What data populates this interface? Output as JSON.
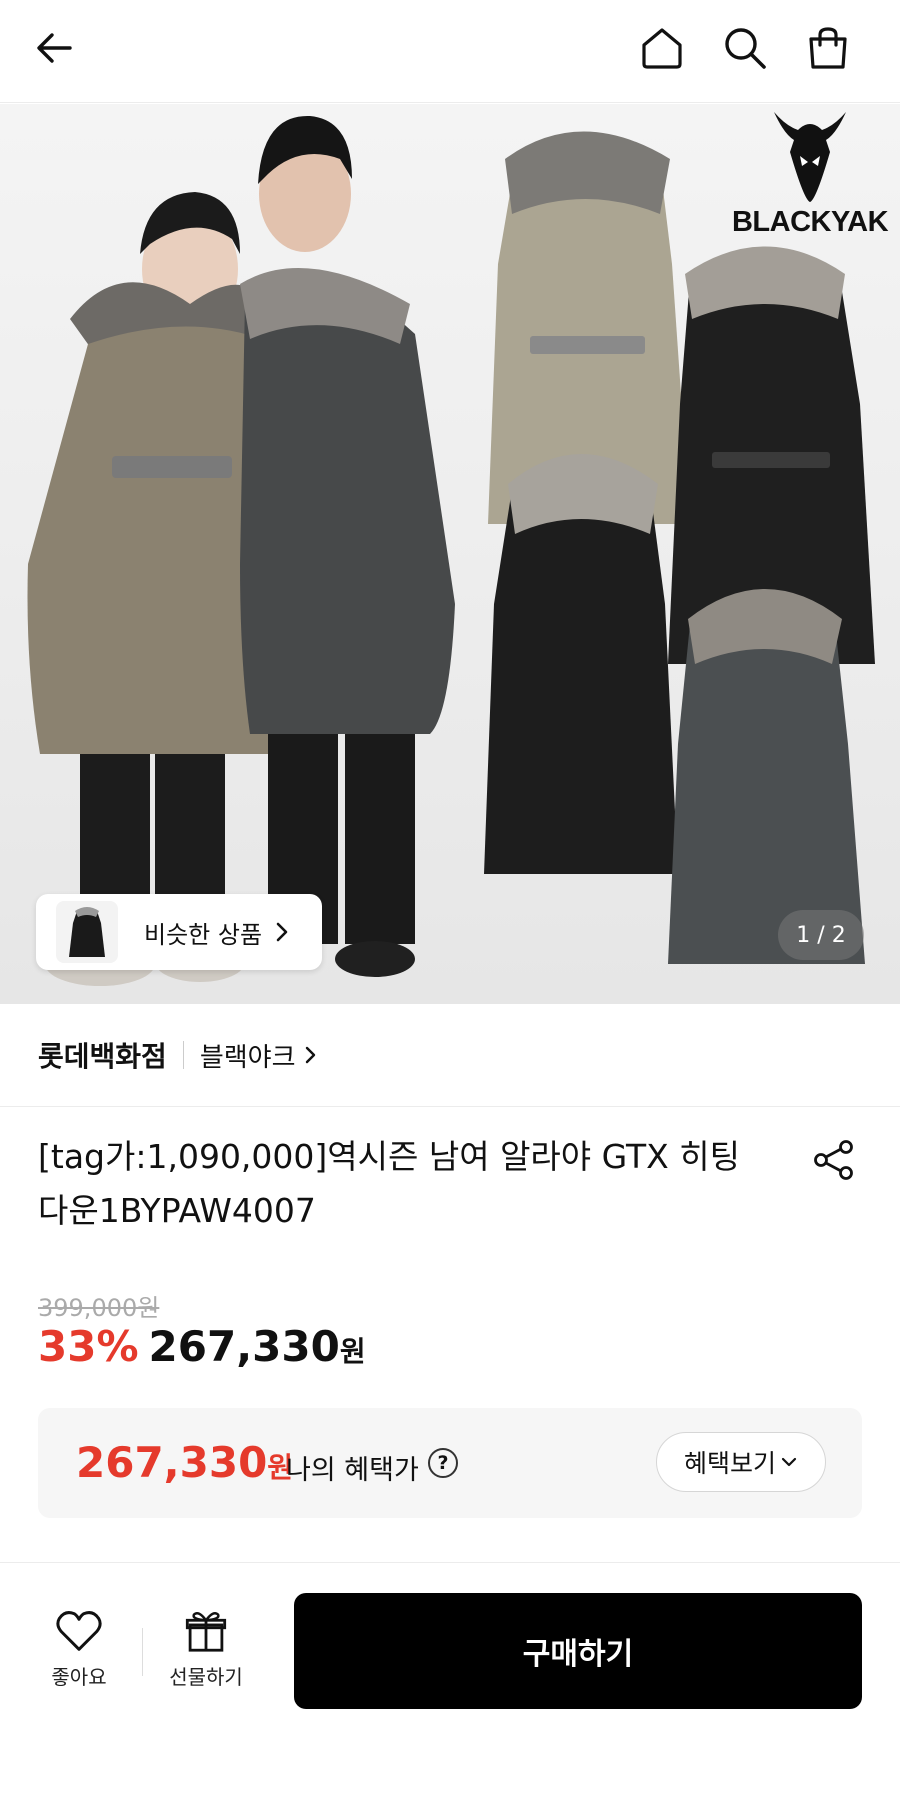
{
  "header": {
    "back_icon": "back-arrow-icon",
    "home_icon": "home-icon",
    "search_icon": "search-icon",
    "cart_icon": "shopping-bag-icon"
  },
  "hero": {
    "brand_logo_text": "BLACKYAK",
    "similar_label": "비슷한 상품",
    "image_counter": "1 / 2"
  },
  "store": {
    "department": "롯데백화점",
    "brand": "블랙야크"
  },
  "product": {
    "title": "[tag가:1,090,000]역시즌 남여 알라야 GTX 히팅 다운1BYPAW4007",
    "original_price": "399,000원",
    "discount": "33%",
    "sale_price": "267,330",
    "currency": "원"
  },
  "benefit": {
    "price": "267,330",
    "currency": "원",
    "label": "나의 혜택가",
    "help_mark": "?",
    "button": "혜택보기"
  },
  "bottom": {
    "like_label": "좋아요",
    "gift_label": "선물하기",
    "buy_label": "구매하기"
  },
  "colors": {
    "accent_red": "#e53a2c",
    "buy_button": "#000000",
    "benefit_bg": "#f6f6f6"
  }
}
